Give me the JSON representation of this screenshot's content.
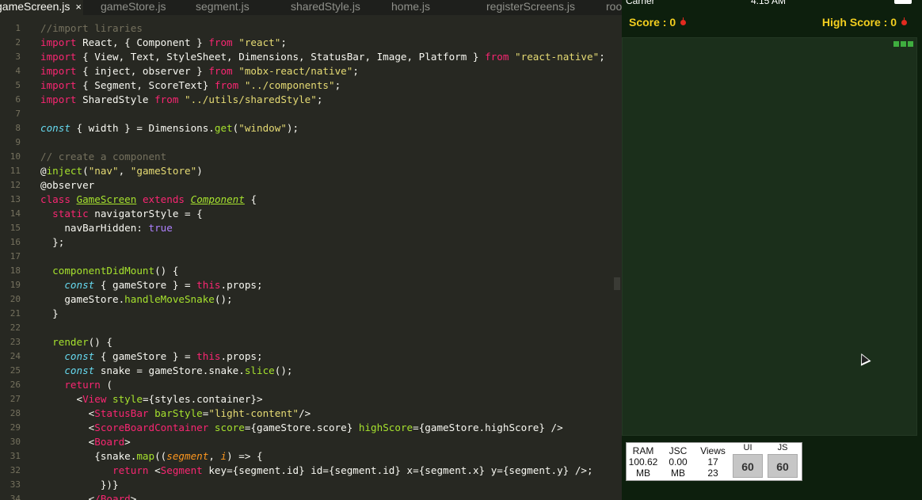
{
  "editor": {
    "tabs": [
      {
        "label": "gameScreen.js",
        "active": true,
        "close": "×"
      },
      {
        "label": "gameStore.js"
      },
      {
        "label": "segment.js"
      },
      {
        "label": "sharedStyle.js"
      },
      {
        "label": "home.js"
      },
      {
        "label": "registerScreens.js"
      },
      {
        "label": "roo"
      }
    ],
    "lines": [
      "//import liraries",
      "import React, { Component } from \"react\";",
      "import { View, Text, StyleSheet, Dimensions, StatusBar, Image, Platform } from \"react-native\";",
      "import { inject, observer } from \"mobx-react/native\";",
      "import { Segment, ScoreText} from \"../components\";",
      "import SharedStyle from \"../utils/sharedStyle\";",
      "",
      "const { width } = Dimensions.get(\"window\");",
      "",
      "// create a component",
      "@inject(\"nav\", \"gameStore\")",
      "@observer",
      "class GameScreen extends Component {",
      "  static navigatorStyle = {",
      "    navBarHidden: true",
      "  };",
      "",
      "  componentDidMount() {",
      "    const { gameStore } = this.props;",
      "    gameStore.handleMoveSnake();",
      "  }",
      "",
      "  render() {",
      "    const { gameStore } = this.props;",
      "    const snake = gameStore.snake.slice();",
      "    return (",
      "      <View style={styles.container}>",
      "        <StatusBar barStyle=\"light-content\"/>",
      "        <ScoreBoardContainer score={gameStore.score} highScore={gameStore.highScore} />",
      "        <Board>",
      "         {snake.map((segment, i) => {",
      "            return <Segment key={segment.id} id={segment.id} x={segment.x} y={segment.y} />;",
      "          })}",
      "        </Board>"
    ]
  },
  "simulator": {
    "status_bar": {
      "carrier": "Carrier",
      "time": "4:15 AM"
    },
    "score_label": "Score : 0",
    "high_score_label": "High Score : 0",
    "perf": {
      "ram_label": "RAM",
      "ram_value": "100.62",
      "ram_unit": "MB",
      "jsc_label": "JSC",
      "jsc_value": "0.00",
      "jsc_unit": "MB",
      "views_label": "Views",
      "views_a": "17",
      "views_b": "23",
      "ui_label": "UI",
      "ui_fps": "60",
      "js_label": "JS",
      "js_fps": "60"
    }
  },
  "colors": {
    "editor_bg": "#272822",
    "simulator_bg": "#0d1f0d",
    "board_bg": "#1b2f1b",
    "score_text": "#f3ce1f",
    "snake": "#3fae3f"
  }
}
